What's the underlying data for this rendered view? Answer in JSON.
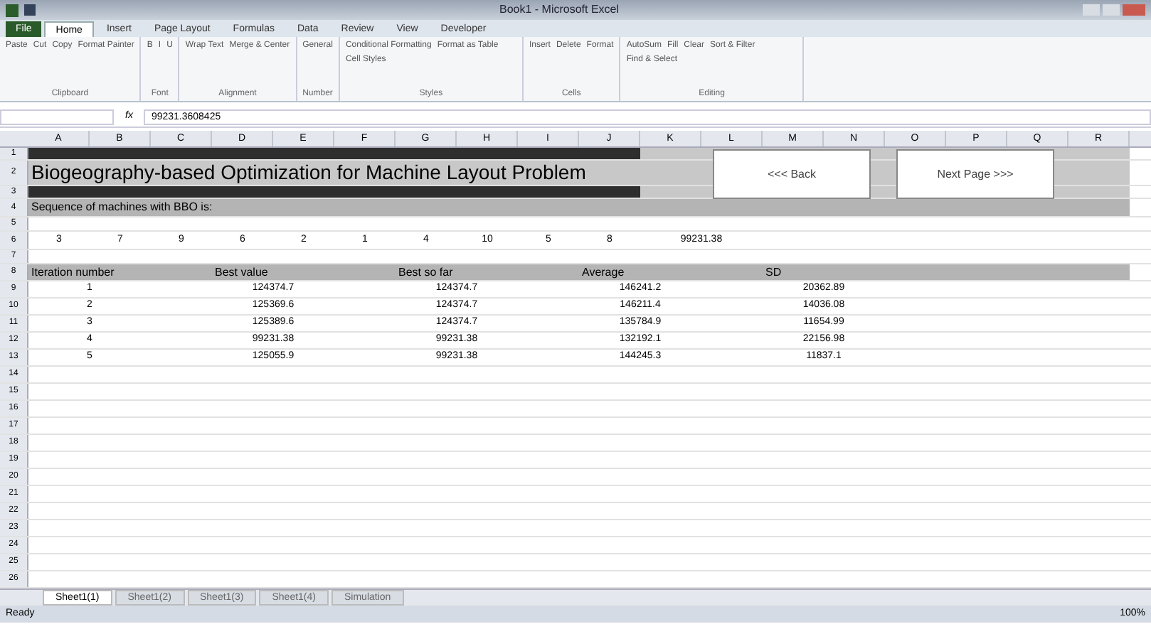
{
  "window": {
    "title": "Book1 - Microsoft Excel"
  },
  "ribbon_tabs": [
    {
      "label": "File",
      "selected": false,
      "kind": "file"
    },
    {
      "label": "Home",
      "selected": true,
      "kind": "tab"
    },
    {
      "label": "Insert",
      "selected": false,
      "kind": "tab"
    },
    {
      "label": "Page Layout",
      "selected": false,
      "kind": "tab"
    },
    {
      "label": "Formulas",
      "selected": false,
      "kind": "tab"
    },
    {
      "label": "Data",
      "selected": false,
      "kind": "tab"
    },
    {
      "label": "Review",
      "selected": false,
      "kind": "tab"
    },
    {
      "label": "View",
      "selected": false,
      "kind": "tab"
    },
    {
      "label": "Developer",
      "selected": false,
      "kind": "tab"
    }
  ],
  "ribbon_groups": [
    {
      "label": "Clipboard",
      "buttons": [
        "Paste",
        "Cut",
        "Copy",
        "Format Painter"
      ]
    },
    {
      "label": "Font",
      "buttons": [
        "B",
        "I",
        "U"
      ]
    },
    {
      "label": "Alignment",
      "buttons": [
        "Wrap Text",
        "Merge & Center"
      ]
    },
    {
      "label": "Number",
      "buttons": [
        "General"
      ]
    },
    {
      "label": "Styles",
      "buttons": [
        "Conditional Formatting",
        "Format as Table",
        "Cell Styles"
      ]
    },
    {
      "label": "Cells",
      "buttons": [
        "Insert",
        "Delete",
        "Format"
      ]
    },
    {
      "label": "Editing",
      "buttons": [
        "AutoSum",
        "Fill",
        "Clear",
        "Sort & Filter",
        "Find & Select"
      ]
    }
  ],
  "formula_bar": {
    "fx": "fx",
    "value": "99231.3608425"
  },
  "rows": [
    "1",
    "2",
    "3",
    "4",
    "5",
    "6",
    "7",
    "8",
    "9",
    "10",
    "11",
    "12",
    "13",
    "14",
    "15",
    "16",
    "17",
    "18",
    "19",
    "20",
    "21",
    "22",
    "23",
    "24",
    "25",
    "26"
  ],
  "columns": [
    "A",
    "B",
    "C",
    "D",
    "E",
    "F",
    "G",
    "H",
    "I",
    "J",
    "K",
    "L",
    "M",
    "N",
    "O",
    "P",
    "Q",
    "R"
  ],
  "sheet": {
    "title": "Biogeography-based Optimization for Machine Layout Problem",
    "sequence_label": "Sequence of machines with BBO is:",
    "sequence": [
      "3",
      "7",
      "9",
      "6",
      "2",
      "1",
      "4",
      "10",
      "5",
      "8"
    ],
    "sequence_result": "99231.38",
    "table_columns": [
      "Iteration number",
      "Best value",
      "Best so far",
      "Average",
      "SD"
    ],
    "table_rows": [
      [
        "1",
        "124374.7",
        "124374.7",
        "146241.2",
        "20362.89"
      ],
      [
        "2",
        "125369.6",
        "124374.7",
        "146211.4",
        "14036.08"
      ],
      [
        "3",
        "125389.6",
        "124374.7",
        "135784.9",
        "11654.99"
      ],
      [
        "4",
        "99231.38",
        "99231.38",
        "132192.1",
        "22156.98"
      ],
      [
        "5",
        "125055.9",
        "99231.38",
        "144245.3",
        "11837.1"
      ]
    ]
  },
  "shape_buttons": [
    "<<< Back",
    "Next Page >>>"
  ],
  "sheet_tabs": [
    {
      "label": "Sheet1(1)",
      "selected": true
    },
    {
      "label": "Sheet1(2)",
      "selected": false
    },
    {
      "label": "Sheet1(3)",
      "selected": false
    },
    {
      "label": "Sheet1(4)",
      "selected": false
    },
    {
      "label": "Simulation",
      "selected": false
    }
  ],
  "status_bar": {
    "text": "Ready",
    "zoom": "100%"
  }
}
